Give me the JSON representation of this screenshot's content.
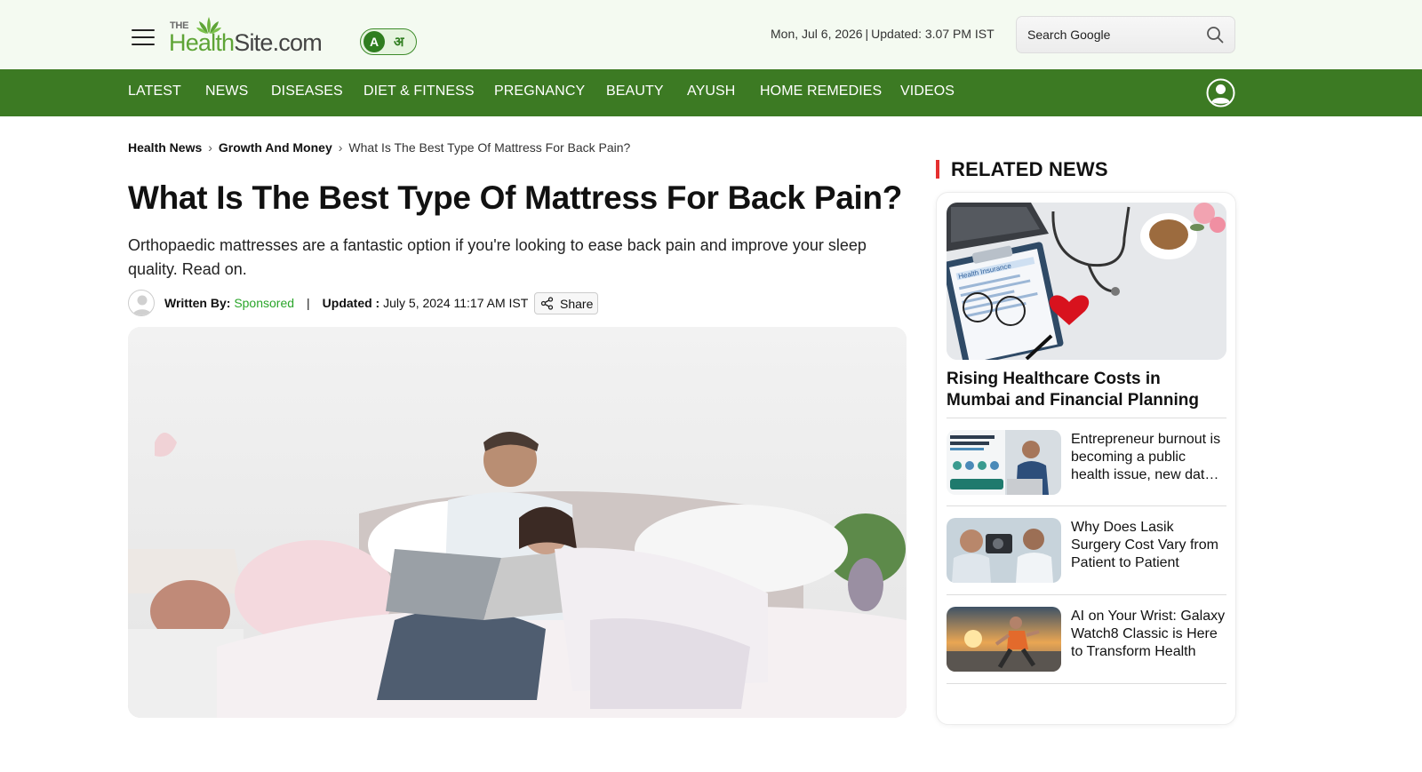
{
  "site": {
    "logo_prefix": "THE",
    "logo_name_green": "Health",
    "logo_name_dark": "Site.com",
    "lang_english": "A",
    "lang_hindi": "अ"
  },
  "header": {
    "date": "Mon, Jul 6, 2026",
    "updated": "Updated: 3.07 PM IST",
    "search_placeholder": "Search Google"
  },
  "nav": {
    "items": [
      "LATEST",
      "NEWS",
      "DISEASES",
      "DIET & FITNESS",
      "PREGNANCY",
      "BEAUTY",
      "AYUSH",
      "HOME REMEDIES",
      "VIDEOS"
    ]
  },
  "breadcrumb": {
    "items": [
      "Health News",
      "Growth And Money"
    ],
    "current": "What Is The Best Type Of Mattress For Back Pain?"
  },
  "article": {
    "title": "What Is The Best Type Of Mattress For Back Pain?",
    "summary": "Orthopaedic mattresses are a fantastic option if you're looking to ease back pain and improve your sleep quality. Read on.",
    "written_by_label": "Written By:",
    "author": "Sponsored",
    "pipe": "|",
    "updated_label": "Updated :",
    "updated_value": "July 5, 2024 11:17 AM IST",
    "share_label": "Share"
  },
  "related": {
    "heading": "RELATED NEWS",
    "feature": {
      "title": "Rising Healthcare Costs in Mumbai and Financial Planning",
      "image_text": "Health Insurance"
    },
    "items": [
      {
        "title": "Entrepreneur burnout is becoming a public health issue, new data suggests"
      },
      {
        "title": "Why Does Lasik Surgery Cost Vary from Patient to Patient"
      },
      {
        "title": "AI on Your Wrist: Galaxy Watch8 Classic is Here to Transform Health"
      }
    ]
  },
  "colors": {
    "nav_green": "#3c7a23",
    "header_bg": "#f4faf1",
    "author_green": "#2aa52a",
    "accent_red": "#e53030"
  }
}
